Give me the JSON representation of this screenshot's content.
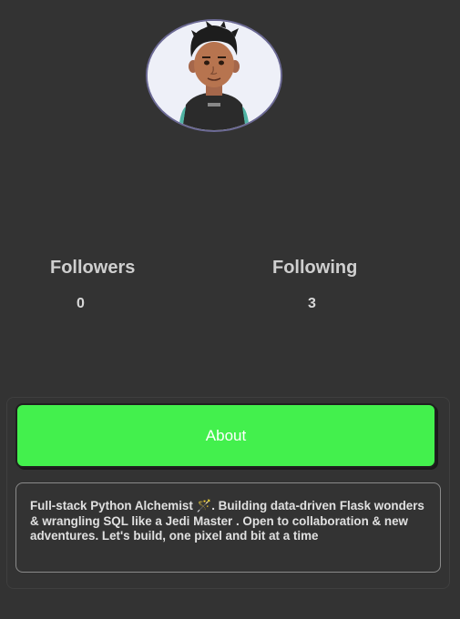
{
  "profile": {
    "avatar_icon": "person-avatar-icon"
  },
  "stats": {
    "followers_label": "Followers",
    "followers_count": "0",
    "following_label": "Following",
    "following_count": "3"
  },
  "about": {
    "button_label": "About",
    "bio": "Full-stack Python Alchemist 🪄. Building data-driven Flask wonders & wrangling SQL like a Jedi Master . Open to collaboration & new adventures. Let's build, one pixel and bit at a time"
  },
  "colors": {
    "background": "#333333",
    "about_button": "#43f04d",
    "text": "#cfcfcf"
  }
}
